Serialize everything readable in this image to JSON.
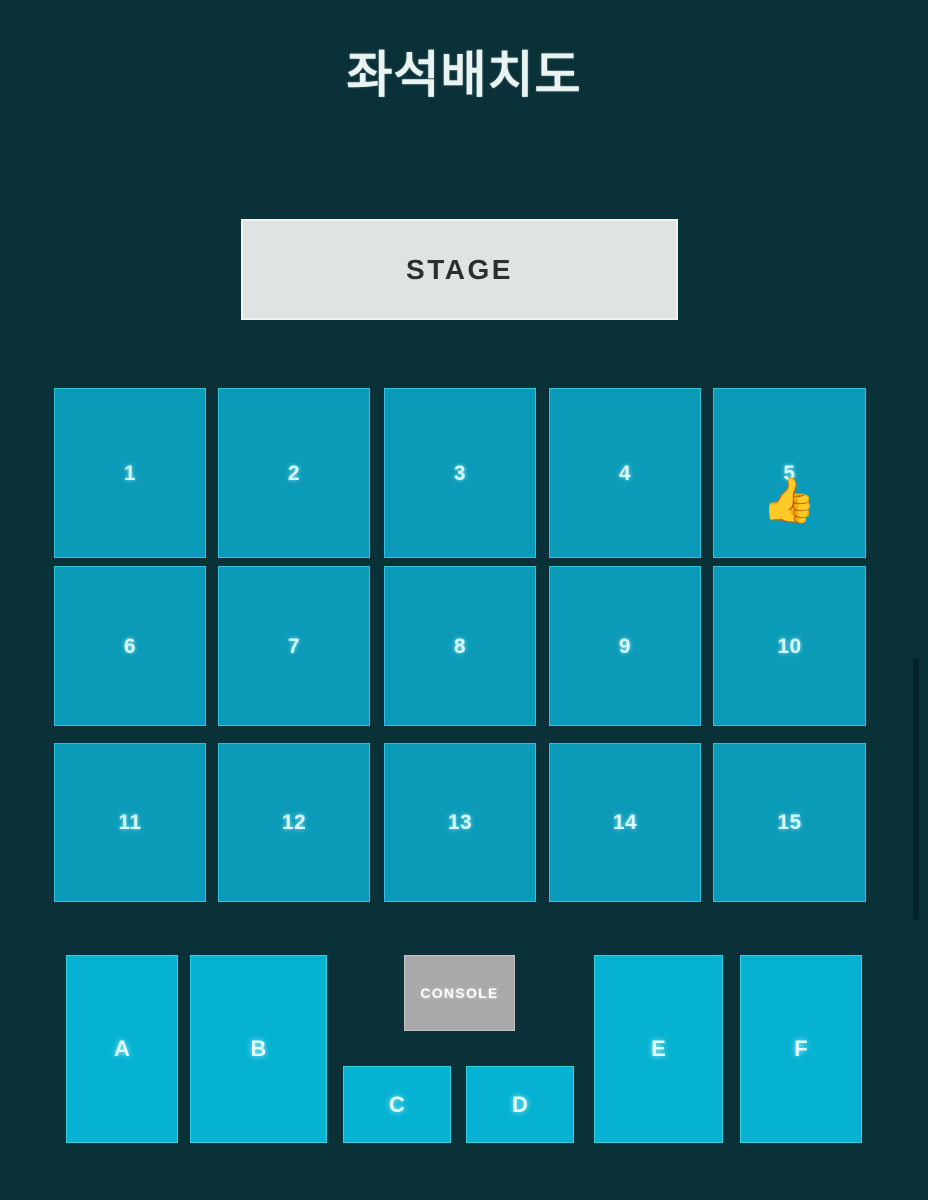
{
  "page": {
    "title": "좌석배치도",
    "background_color": "#0a3038",
    "title_color": "#e9f3f2"
  },
  "stage": {
    "label": "STAGE",
    "background_color": "#dfe3e2",
    "text_color": "#2b2f2f"
  },
  "console": {
    "label": "CONSOLE",
    "background_color": "#a9a9a9",
    "text_color": "#ffffff"
  },
  "seat_color": "#0b9ab7",
  "zone_color": "#06b2d2",
  "seat_rows": [
    {
      "row": 1,
      "seats": [
        {
          "label": "1",
          "emoji": ""
        },
        {
          "label": "2",
          "emoji": ""
        },
        {
          "label": "3",
          "emoji": ""
        },
        {
          "label": "4",
          "emoji": ""
        },
        {
          "label": "5",
          "emoji": "👍"
        }
      ]
    },
    {
      "row": 2,
      "seats": [
        {
          "label": "6",
          "emoji": ""
        },
        {
          "label": "7",
          "emoji": ""
        },
        {
          "label": "8",
          "emoji": ""
        },
        {
          "label": "9",
          "emoji": ""
        },
        {
          "label": "10",
          "emoji": ""
        }
      ]
    },
    {
      "row": 3,
      "seats": [
        {
          "label": "11",
          "emoji": ""
        },
        {
          "label": "12",
          "emoji": ""
        },
        {
          "label": "13",
          "emoji": ""
        },
        {
          "label": "14",
          "emoji": ""
        },
        {
          "label": "15",
          "emoji": ""
        }
      ]
    }
  ],
  "zones": [
    {
      "label": "A"
    },
    {
      "label": "B"
    },
    {
      "label": "C"
    },
    {
      "label": "D"
    },
    {
      "label": "E"
    },
    {
      "label": "F"
    }
  ],
  "selected_seat": "5"
}
